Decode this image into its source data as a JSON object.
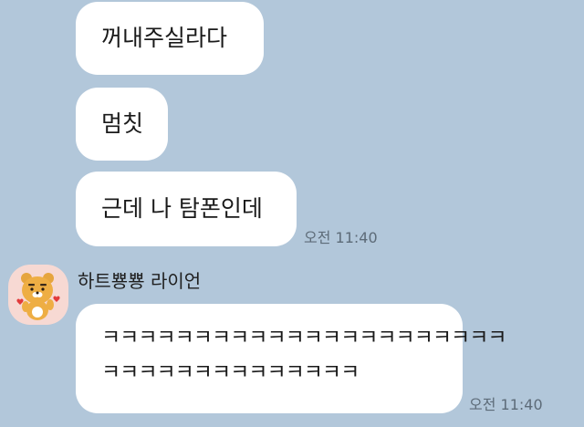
{
  "messages": [
    {
      "text": "꺼내주실라다"
    },
    {
      "text": "멈칫"
    },
    {
      "text": "근데 나 탐폰인데",
      "time": "오전 11:40"
    }
  ],
  "reply": {
    "sender": "하트뿅뿅 라이언",
    "lines": [
      "ㅋㅋㅋㅋㅋㅋㅋㅋㅋㅋㅋㅋㅋㅋㅋㅋㅋㅋㅋㅋㅋㅋ",
      "ㅋㅋㅋㅋㅋㅋㅋㅋㅋㅋㅋㅋㅋㅋ"
    ],
    "time": "오전 11:40",
    "avatar_icon": "ryan-character-icon"
  },
  "colors": {
    "background": "#b2c7da",
    "bubble": "#ffffff",
    "avatar_bg": "#f7d9d3"
  }
}
